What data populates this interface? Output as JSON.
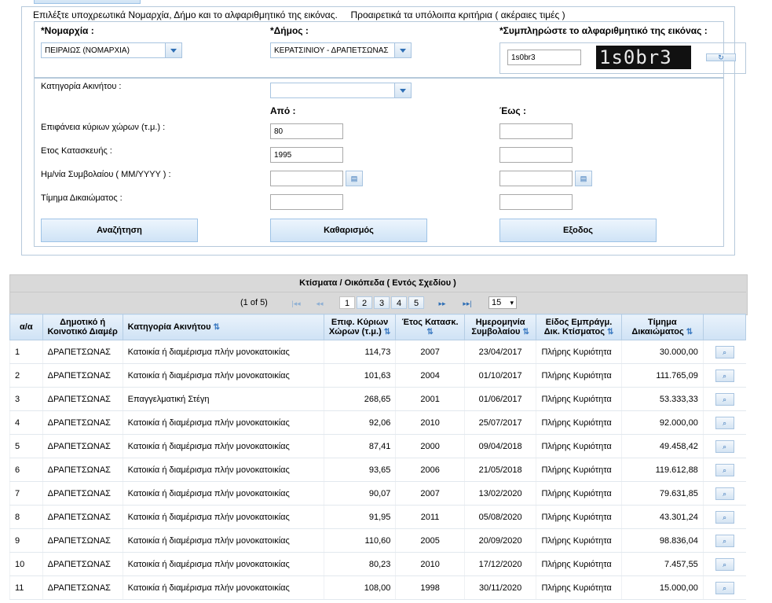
{
  "instructions": {
    "required": "Επιλέξτε υποχρεωτικά Νομαρχία, Δήμο και το αλφαριθμητικό της εικόνας.",
    "optional": "Προαιρετικά τα υπόλοιπα κριτήρια ( ακέραιες τιμές )"
  },
  "form": {
    "prefecture_label": "*Νομαρχία :",
    "prefecture_value": "ΠΕΙΡΑΙΩΣ (ΝΟΜΑΡΧΙΑ)",
    "municipality_label": "*Δήμος :",
    "municipality_value": "ΚΕΡΑΤΣΙΝΙΟΥ - ΔΡΑΠΕΤΣΩΝΑΣ",
    "captcha_label": "*Συμπληρώστε το αλφαριθμητικό της εικόνας :",
    "captcha_input": "1s0br3",
    "captcha_image_text": "1s0br3",
    "category_label": "Κατηγορία Ακινήτου :",
    "category_value": "",
    "from_label": "Από :",
    "to_label": "Έως :",
    "area_label": "Επιφάνεια κύριων χώρων (τ.μ.) :",
    "area_from": "80",
    "area_to": "",
    "year_label": "Ετος Κατασκευής :",
    "year_from": "1995",
    "year_to": "",
    "date_label": "Ημ/νία Συμβολαίου ( MM/YYYY ) :",
    "date_from": "",
    "date_to": "",
    "price_label": "Τίμημα Δικαιώματος :",
    "price_from": "",
    "price_to": "",
    "search_btn": "Αναζήτηση",
    "clear_btn": "Καθαρισμός",
    "exit_btn": "Εξοδος"
  },
  "results": {
    "title": "Κτίσματα / Οικόπεδα ( Εντός Σχεδίου )",
    "page_info": "(1 of 5)",
    "pages": [
      "1",
      "2",
      "3",
      "4",
      "5"
    ],
    "rows_per_page": "15",
    "columns": {
      "aa": "α/α",
      "municipality": "Δημοτικό ή Κοινοτικό Διαμέρ",
      "category": "Κατηγορία Ακινήτου",
      "area": "Επιφ. Κύριων Χώρων (τ.μ.)",
      "year": "Έτος Κατασκ.",
      "date": "Ημερομηνία Συμβολαίου",
      "right": "Είδος Εμπράγμ. Δικ. Κτίσματος",
      "price": "Τίμημα Δικαιώματος"
    },
    "rows": [
      {
        "aa": "1",
        "mun": "ΔΡΑΠΕΤΣΩΝΑΣ",
        "cat": "Κατοικία ή διαμέρισμα πλήν μονοκατοικίας",
        "area": "114,73",
        "year": "2007",
        "date": "23/04/2017",
        "right": "Πλήρης Κυριότητα",
        "price": "30.000,00"
      },
      {
        "aa": "2",
        "mun": "ΔΡΑΠΕΤΣΩΝΑΣ",
        "cat": "Κατοικία ή διαμέρισμα πλήν μονοκατοικίας",
        "area": "101,63",
        "year": "2004",
        "date": "01/10/2017",
        "right": "Πλήρης Κυριότητα",
        "price": "111.765,09"
      },
      {
        "aa": "3",
        "mun": "ΔΡΑΠΕΤΣΩΝΑΣ",
        "cat": "Επαγγελματική Στέγη",
        "area": "268,65",
        "year": "2001",
        "date": "01/06/2017",
        "right": "Πλήρης Κυριότητα",
        "price": "53.333,33"
      },
      {
        "aa": "4",
        "mun": "ΔΡΑΠΕΤΣΩΝΑΣ",
        "cat": "Κατοικία ή διαμέρισμα πλήν μονοκατοικίας",
        "area": "92,06",
        "year": "2010",
        "date": "25/07/2017",
        "right": "Πλήρης Κυριότητα",
        "price": "92.000,00"
      },
      {
        "aa": "5",
        "mun": "ΔΡΑΠΕΤΣΩΝΑΣ",
        "cat": "Κατοικία ή διαμέρισμα πλήν μονοκατοικίας",
        "area": "87,41",
        "year": "2000",
        "date": "09/04/2018",
        "right": "Πλήρης Κυριότητα",
        "price": "49.458,42"
      },
      {
        "aa": "6",
        "mun": "ΔΡΑΠΕΤΣΩΝΑΣ",
        "cat": "Κατοικία ή διαμέρισμα πλήν μονοκατοικίας",
        "area": "93,65",
        "year": "2006",
        "date": "21/05/2018",
        "right": "Πλήρης Κυριότητα",
        "price": "119.612,88"
      },
      {
        "aa": "7",
        "mun": "ΔΡΑΠΕΤΣΩΝΑΣ",
        "cat": "Κατοικία ή διαμέρισμα πλήν μονοκατοικίας",
        "area": "90,07",
        "year": "2007",
        "date": "13/02/2020",
        "right": "Πλήρης Κυριότητα",
        "price": "79.631,85"
      },
      {
        "aa": "8",
        "mun": "ΔΡΑΠΕΤΣΩΝΑΣ",
        "cat": "Κατοικία ή διαμέρισμα πλήν μονοκατοικίας",
        "area": "91,95",
        "year": "2011",
        "date": "05/08/2020",
        "right": "Πλήρης Κυριότητα",
        "price": "43.301,24"
      },
      {
        "aa": "9",
        "mun": "ΔΡΑΠΕΤΣΩΝΑΣ",
        "cat": "Κατοικία ή διαμέρισμα πλήν μονοκατοικίας",
        "area": "110,60",
        "year": "2005",
        "date": "20/09/2020",
        "right": "Πλήρης Κυριότητα",
        "price": "98.836,04"
      },
      {
        "aa": "10",
        "mun": "ΔΡΑΠΕΤΣΩΝΑΣ",
        "cat": "Κατοικία ή διαμέρισμα πλήν μονοκατοικίας",
        "area": "80,23",
        "year": "2010",
        "date": "17/12/2020",
        "right": "Πλήρης Κυριότητα",
        "price": "7.457,55"
      },
      {
        "aa": "11",
        "mun": "ΔΡΑΠΕΤΣΩΝΑΣ",
        "cat": "Κατοικία ή διαμέρισμα πλήν μονοκατοικίας",
        "area": "108,00",
        "year": "1998",
        "date": "30/11/2020",
        "right": "Πλήρης Κυριότητα",
        "price": "15.000,00"
      }
    ]
  }
}
